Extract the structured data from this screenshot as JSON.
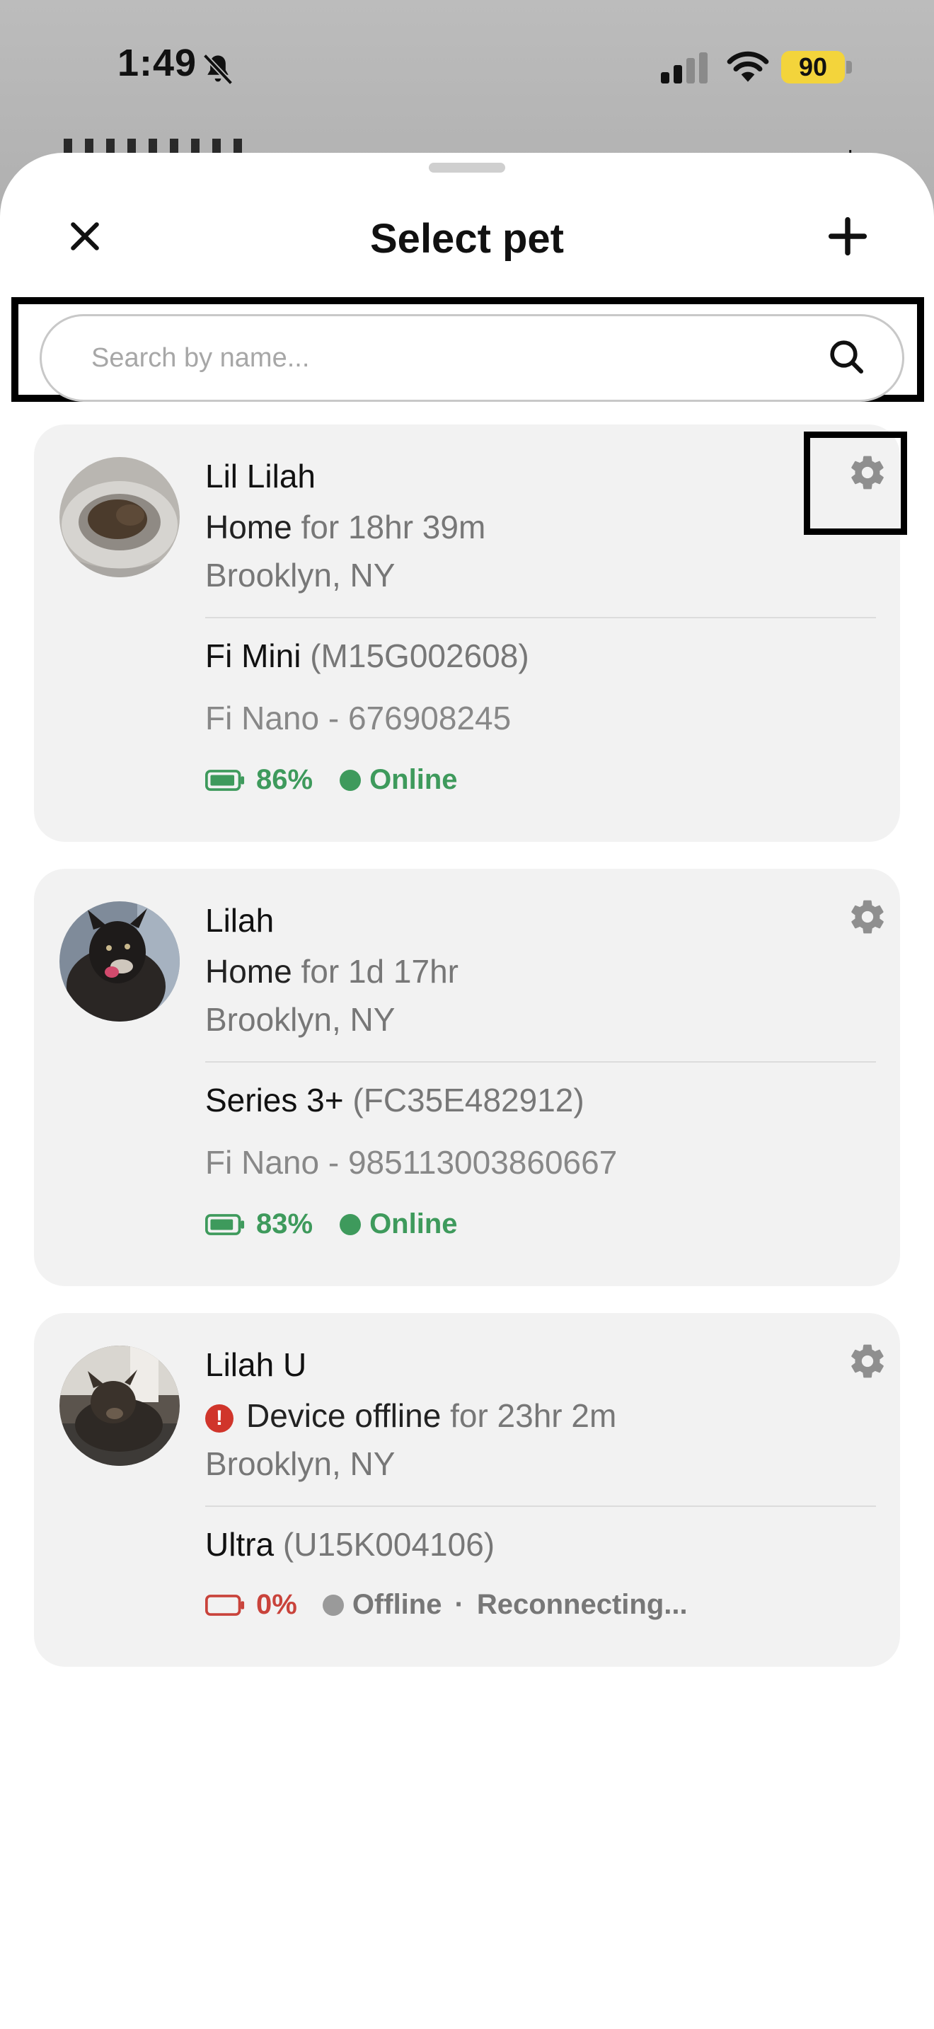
{
  "status_bar": {
    "time": "1:49",
    "battery_level": "90"
  },
  "sheet": {
    "title": "Select pet"
  },
  "search": {
    "placeholder": "Search by name..."
  },
  "pets": [
    {
      "name": "Lil Lilah",
      "status": "Home",
      "status_duration": "for 18hr 39m",
      "location": "Brooklyn, NY",
      "device_model": "Fi Mini",
      "device_serial": "(M15G002608)",
      "secondary_device": "Fi Nano - 676908245",
      "battery": "86%",
      "connection": "Online",
      "connection_detail": ""
    },
    {
      "name": "Lilah",
      "status": "Home",
      "status_duration": "for 1d 17hr",
      "location": "Brooklyn, NY",
      "device_model": "Series 3+",
      "device_serial": "(FC35E482912)",
      "secondary_device": "Fi Nano - 985113003860667",
      "battery": "83%",
      "connection": "Online",
      "connection_detail": ""
    },
    {
      "name": "Lilah U",
      "status": "Device offline",
      "status_duration": "for 23hr 2m",
      "location": "Brooklyn, NY",
      "device_model": "Ultra",
      "device_serial": "(U15K004106)",
      "secondary_device": "",
      "battery": "0%",
      "connection": "Offline",
      "connection_detail": "Reconnecting..."
    }
  ],
  "colors": {
    "online": "#3e9a5c",
    "offline": "#9a9a9a",
    "battery_low": "#c9433b",
    "alert": "#d0352b",
    "card_bg": "#f2f2f2"
  },
  "icons": {
    "close": "close-icon",
    "add": "plus-icon",
    "search": "search-icon",
    "settings": "gear-icon",
    "battery": "battery-icon",
    "alert": "alert-icon"
  }
}
